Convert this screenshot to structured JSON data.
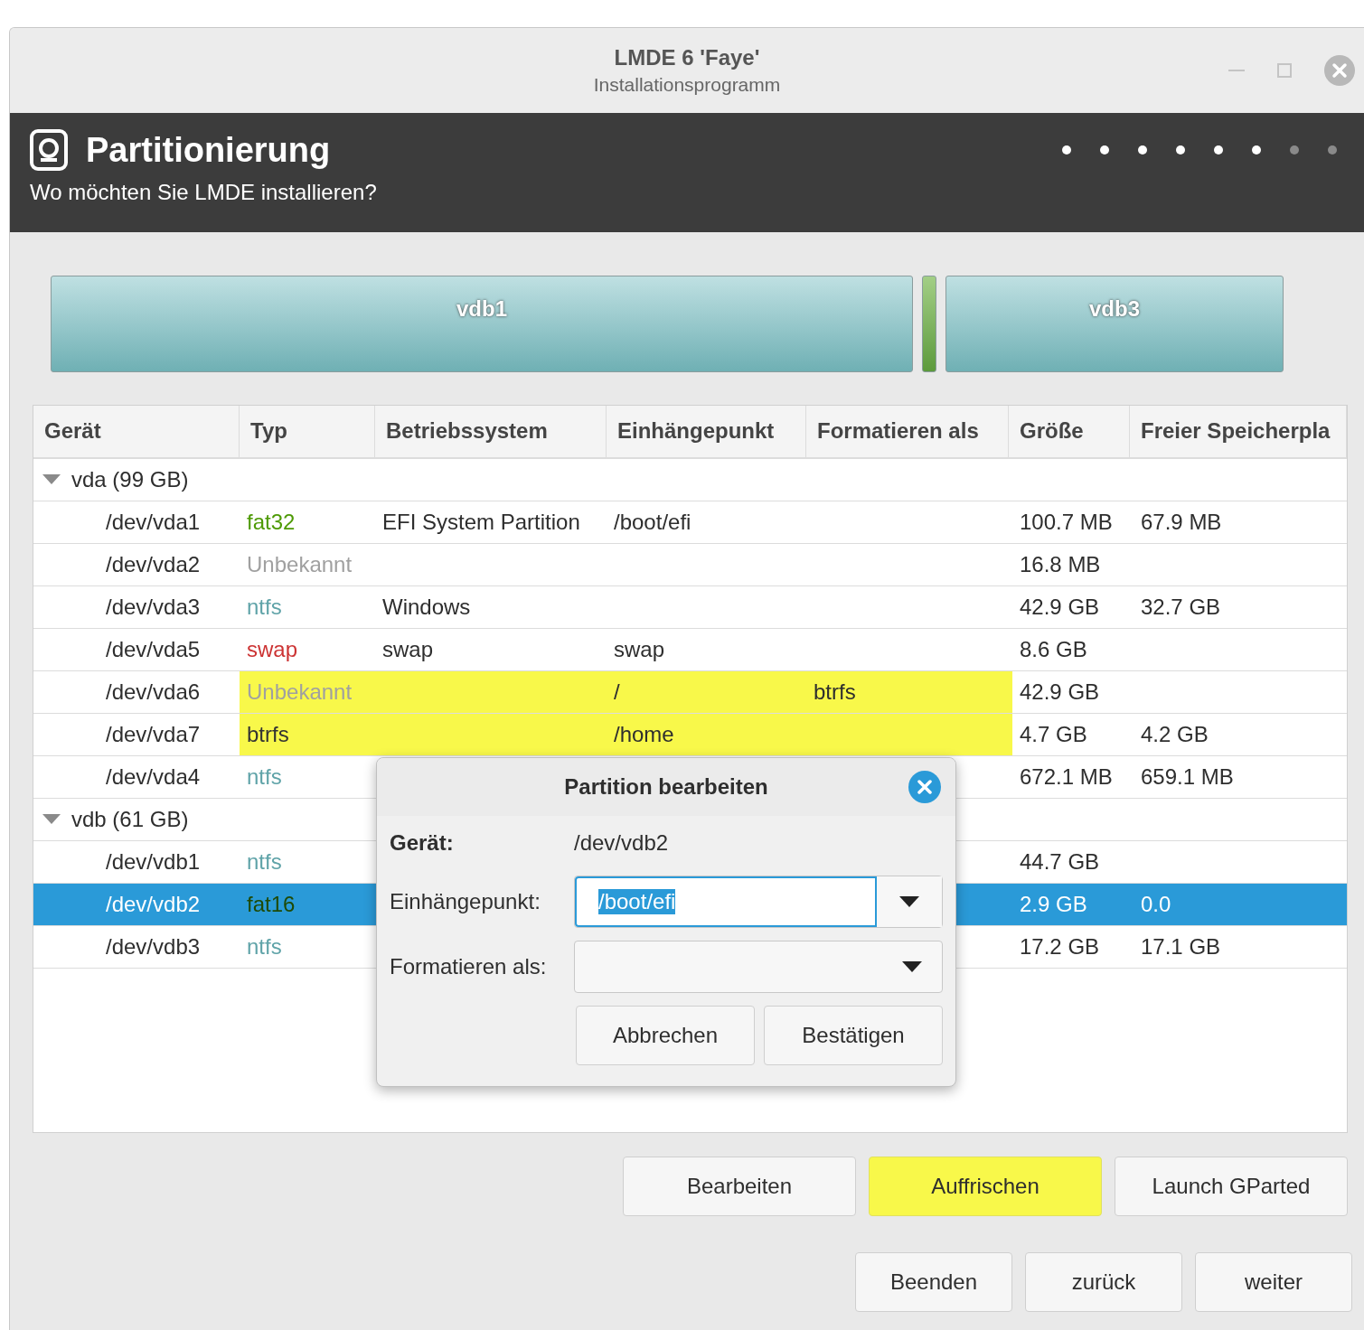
{
  "window": {
    "title": "LMDE 6 'Faye'",
    "subtitle": "Installationsprogramm"
  },
  "header": {
    "title": "Partitionierung",
    "subtitle": "Wo möchten Sie LMDE installieren?",
    "steps": [
      {
        "done": true
      },
      {
        "done": true
      },
      {
        "done": true
      },
      {
        "done": true
      },
      {
        "done": true
      },
      {
        "done": true
      },
      {
        "done": false
      },
      {
        "done": false
      }
    ]
  },
  "partition_bar": [
    {
      "kind": "labeled",
      "label": "vdb1"
    },
    {
      "kind": "unlabeled"
    },
    {
      "kind": "labeled",
      "label": "vdb3"
    }
  ],
  "table": {
    "columns": [
      "Gerät",
      "Typ",
      "Betriebssystem",
      "Einhängepunkt",
      "Formatieren als",
      "Größe",
      "Freier Speicherpla"
    ],
    "rows": [
      {
        "kind": "group",
        "label": "vda (99 GB)",
        "expanded": true
      },
      {
        "kind": "partition",
        "device": "/dev/vda1",
        "type": "fat32",
        "color": "#4e9a06",
        "os": "EFI System Partition",
        "mount": "/boot/efi",
        "format": "",
        "size": "100.7 MB",
        "free": "67.9 MB",
        "highlighted": false,
        "selected": false
      },
      {
        "kind": "partition",
        "device": "/dev/vda2",
        "type": "Unbekannt",
        "color": "#a0a0a0",
        "os": "",
        "mount": "",
        "format": "",
        "size": "16.8 MB",
        "free": "",
        "highlighted": false,
        "selected": false
      },
      {
        "kind": "partition",
        "device": "/dev/vda3",
        "type": "ntfs",
        "color": "#5fa3a8",
        "os": "Windows",
        "mount": "",
        "format": "",
        "size": "42.9 GB",
        "free": "32.7 GB",
        "highlighted": false,
        "selected": false
      },
      {
        "kind": "partition",
        "device": "/dev/vda5",
        "type": "swap",
        "color": "#cc3333",
        "os": "swap",
        "mount": "swap",
        "format": "",
        "size": "8.6 GB",
        "free": "",
        "highlighted": false,
        "selected": false
      },
      {
        "kind": "partition",
        "device": "/dev/vda6",
        "type": "Unbekannt",
        "color": "#a0a0a0",
        "os": "",
        "mount": "/",
        "format": "btrfs",
        "size": "42.9 GB",
        "free": "",
        "highlighted": true,
        "selected": false
      },
      {
        "kind": "partition",
        "device": "/dev/vda7",
        "type": "btrfs",
        "color": "#333333",
        "os": "",
        "mount": "/home",
        "format": "",
        "size": "4.7 GB",
        "free": "4.2 GB",
        "highlighted": true,
        "selected": false
      },
      {
        "kind": "partition",
        "device": "/dev/vda4",
        "type": "ntfs",
        "color": "#5fa3a8",
        "os": "",
        "mount": "",
        "format": "",
        "size": "672.1 MB",
        "free": "659.1 MB",
        "highlighted": false,
        "selected": false
      },
      {
        "kind": "group",
        "label": "vdb (61 GB)",
        "expanded": true
      },
      {
        "kind": "partition",
        "device": "/dev/vdb1",
        "type": "ntfs",
        "color": "#5fa3a8",
        "os": "",
        "mount": "",
        "format": "",
        "size": "44.7 GB",
        "free": "",
        "highlighted": false,
        "selected": false
      },
      {
        "kind": "partition",
        "device": "/dev/vdb2",
        "type": "fat16",
        "color": "#1e4a05",
        "os": "",
        "mount": "",
        "format": "",
        "size": "2.9 GB",
        "free": "0.0",
        "highlighted": false,
        "selected": true
      },
      {
        "kind": "partition",
        "device": "/dev/vdb3",
        "type": "ntfs",
        "color": "#5fa3a8",
        "os": "",
        "mount": "",
        "format": "",
        "size": "17.2 GB",
        "free": "17.1 GB",
        "highlighted": false,
        "selected": false
      }
    ]
  },
  "dialog": {
    "title": "Partition bearbeiten",
    "device_label": "Gerät:",
    "device_value": "/dev/vdb2",
    "mount_label": "Einhängepunkt:",
    "mount_value": "/boot/efi",
    "format_label": "Formatieren als:",
    "buttons": [
      "Abbrechen",
      "Bestätigen"
    ]
  },
  "actions": [
    {
      "label": "Bearbeiten",
      "highlighted": false
    },
    {
      "label": "Auffrischen",
      "highlighted": true
    },
    {
      "label": "Launch GParted",
      "highlighted": false
    }
  ],
  "navigation": [
    "Beenden",
    "zurück",
    "weiter"
  ]
}
